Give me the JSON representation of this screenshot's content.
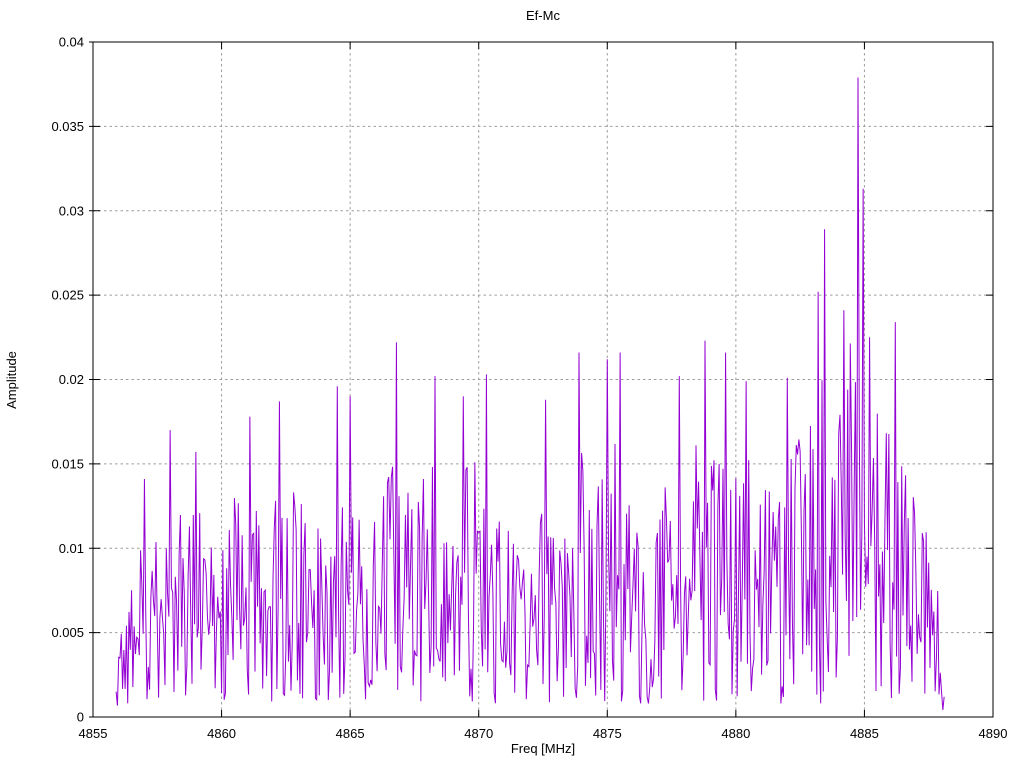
{
  "chart_data": {
    "type": "line",
    "title": "Ef-Mc",
    "xlabel": "Freq [MHz]",
    "ylabel": "Amplitude",
    "xlim": [
      4855,
      4890
    ],
    "ylim": [
      0,
      0.04
    ],
    "xticks": [
      4855,
      4860,
      4865,
      4870,
      4875,
      4880,
      4885,
      4890
    ],
    "yticks": [
      0,
      0.005,
      0.01,
      0.015,
      0.02,
      0.025,
      0.03,
      0.035,
      0.04
    ],
    "ytick_labels": [
      "0",
      "0.005",
      "0.01",
      "0.015",
      "0.02",
      "0.025",
      "0.03",
      "0.035",
      "0.04"
    ],
    "grid": true,
    "legend": "none",
    "line_color": "#9400d3",
    "grid_color": "#9c9c9c",
    "border_color": "#000000",
    "series": {
      "name": "Ef-Mc",
      "x_start": 4855.9,
      "x_end": 4888.1,
      "n_points": 645,
      "noise_seed": 77,
      "floor": 0.0008,
      "envelope_hi": [
        [
          4855.9,
          0.007
        ],
        [
          4856.4,
          0.01
        ],
        [
          4857.0,
          0.013
        ],
        [
          4857.6,
          0.012
        ],
        [
          4858.1,
          0.0155
        ],
        [
          4858.7,
          0.0135
        ],
        [
          4859.2,
          0.0145
        ],
        [
          4859.8,
          0.0125
        ],
        [
          4860.3,
          0.0145
        ],
        [
          4861.0,
          0.016
        ],
        [
          4861.7,
          0.0135
        ],
        [
          4862.3,
          0.0165
        ],
        [
          4863.0,
          0.0155
        ],
        [
          4863.6,
          0.0125
        ],
        [
          4864.3,
          0.0165
        ],
        [
          4865.0,
          0.0175
        ],
        [
          4865.7,
          0.015
        ],
        [
          4866.4,
          0.016
        ],
        [
          4866.9,
          0.019
        ],
        [
          4867.5,
          0.016
        ],
        [
          4868.2,
          0.018
        ],
        [
          4868.9,
          0.015
        ],
        [
          4869.5,
          0.017
        ],
        [
          4870.2,
          0.018
        ],
        [
          4870.9,
          0.015
        ],
        [
          4871.5,
          0.012
        ],
        [
          4872.2,
          0.0135
        ],
        [
          4872.8,
          0.0165
        ],
        [
          4873.5,
          0.015
        ],
        [
          4874.0,
          0.0185
        ],
        [
          4874.6,
          0.016
        ],
        [
          4875.3,
          0.019
        ],
        [
          4876.0,
          0.013
        ],
        [
          4876.7,
          0.012
        ],
        [
          4877.3,
          0.016
        ],
        [
          4878.0,
          0.018
        ],
        [
          4878.7,
          0.019
        ],
        [
          4879.4,
          0.017
        ],
        [
          4880.0,
          0.0185
        ],
        [
          4880.7,
          0.017
        ],
        [
          4881.4,
          0.0165
        ],
        [
          4882.0,
          0.0185
        ],
        [
          4882.7,
          0.019
        ],
        [
          4883.3,
          0.023
        ],
        [
          4883.9,
          0.02
        ],
        [
          4884.5,
          0.026
        ],
        [
          4885.0,
          0.024
        ],
        [
          4885.6,
          0.02
        ],
        [
          4886.1,
          0.0205
        ],
        [
          4886.7,
          0.018
        ],
        [
          4887.2,
          0.013
        ],
        [
          4887.7,
          0.012
        ],
        [
          4888.1,
          0.006
        ]
      ],
      "peaks": [
        [
          4855.9,
          0.0015
        ],
        [
          4857.0,
          0.0141
        ],
        [
          4858.0,
          0.017
        ],
        [
          4859.0,
          0.0157
        ],
        [
          4861.1,
          0.0178
        ],
        [
          4862.25,
          0.0187
        ],
        [
          4864.5,
          0.0196
        ],
        [
          4865.0,
          0.019
        ],
        [
          4866.8,
          0.0222
        ],
        [
          4868.3,
          0.0202
        ],
        [
          4869.4,
          0.019
        ],
        [
          4870.3,
          0.0203
        ],
        [
          4872.6,
          0.0188
        ],
        [
          4873.9,
          0.0216
        ],
        [
          4875.0,
          0.0212
        ],
        [
          4875.5,
          0.0216
        ],
        [
          4877.8,
          0.0202
        ],
        [
          4878.8,
          0.0223
        ],
        [
          4879.6,
          0.0216
        ],
        [
          4880.4,
          0.0199
        ],
        [
          4882.0,
          0.0201
        ],
        [
          4883.2,
          0.0252
        ],
        [
          4883.45,
          0.0289
        ],
        [
          4884.2,
          0.0241
        ],
        [
          4884.75,
          0.0379
        ],
        [
          4884.95,
          0.0313
        ],
        [
          4885.2,
          0.0225
        ],
        [
          4886.2,
          0.0234
        ],
        [
          4888.1,
          0.0012
        ]
      ]
    }
  }
}
